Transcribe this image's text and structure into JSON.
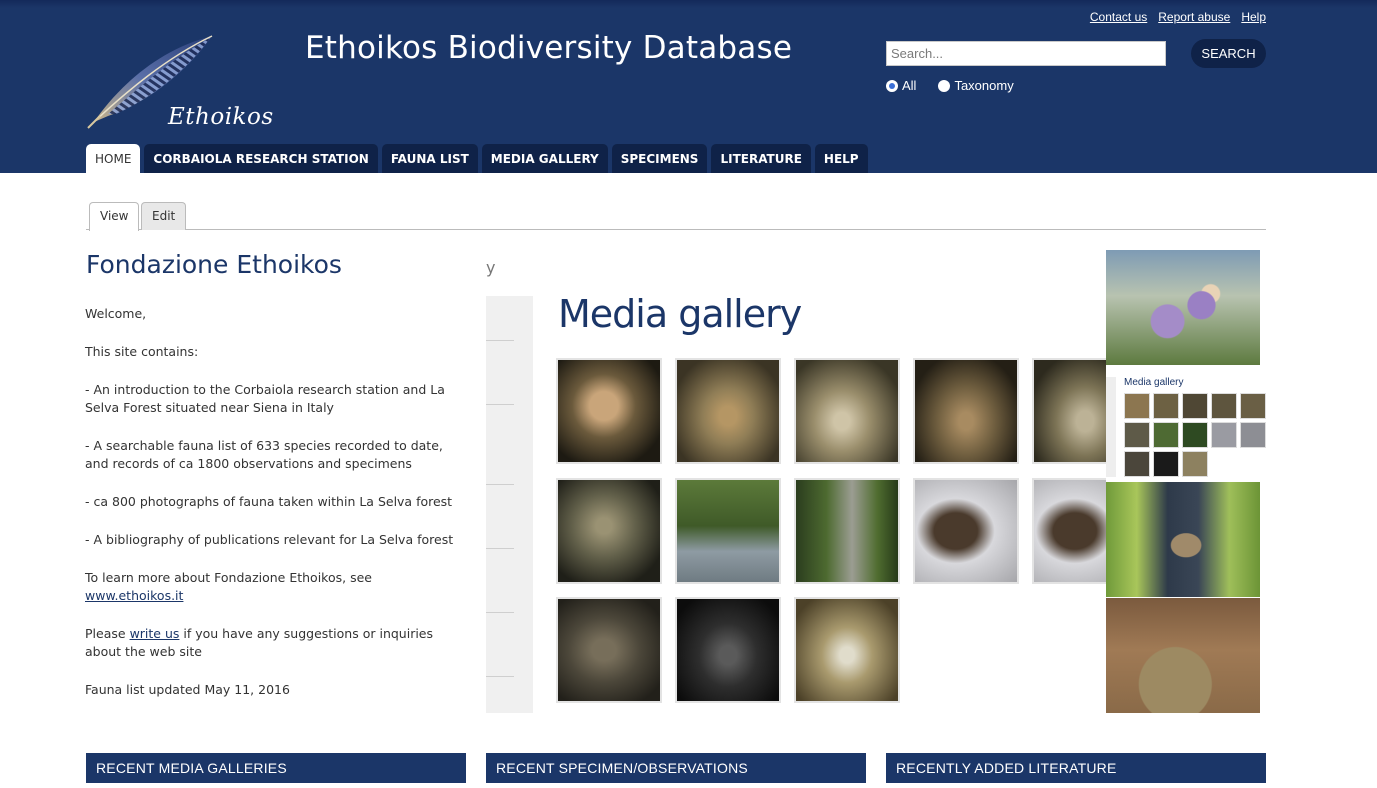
{
  "header": {
    "logo_text": "Ethoikos",
    "site_title": "Ethoikos Biodiversity Database",
    "util_links": [
      "Contact us",
      "Report abuse",
      "Help"
    ],
    "search": {
      "placeholder": "Search...",
      "button": "SEARCH"
    },
    "scope": {
      "options": [
        "All",
        "Taxonomy"
      ],
      "selected": "All"
    }
  },
  "nav": {
    "tabs": [
      "HOME",
      "CORBAIOLA RESEARCH STATION",
      "FAUNA LIST",
      "MEDIA GALLERY",
      "SPECIMENS",
      "LITERATURE",
      "HELP"
    ],
    "active": "HOME"
  },
  "local_tabs": {
    "view": "View",
    "edit": "Edit",
    "active": "View"
  },
  "content": {
    "title": "Fondazione Ethoikos",
    "welcome": "Welcome,",
    "contains": "This site contains:",
    "item1": "- An introduction to the Corbaiola research station and La Selva Forest situated near Siena in Italy",
    "item2": "- A searchable fauna list of 633 species recorded to date, and records of ca 1800 observations and specimens",
    "item3": "- ca 800 photographs of fauna taken within La Selva forest",
    "item4": "- A bibliography of publications relevant for La Selva forest",
    "learn_prefix": "To learn more about Fondazione Ethoikos, see",
    "learn_link": "www.ethoikos.it",
    "write_prefix": "Please",
    "write_link": "write us",
    "write_suffix": "if you have any suggestions or inquiries about the web site",
    "updated": "Fauna list updated May 11, 2016"
  },
  "media_shot": {
    "crumb": "y",
    "title": "Media gallery",
    "mini_title": "Media gallery"
  },
  "blocks": {
    "media": "RECENT MEDIA GALLERIES",
    "specimens": "RECENT SPECIMEN/OBSERVATIONS",
    "literature": "RECENTLY ADDED LITERATURE"
  },
  "colors": {
    "brand": "#1b3668",
    "nav_dark": "#0f2248"
  }
}
